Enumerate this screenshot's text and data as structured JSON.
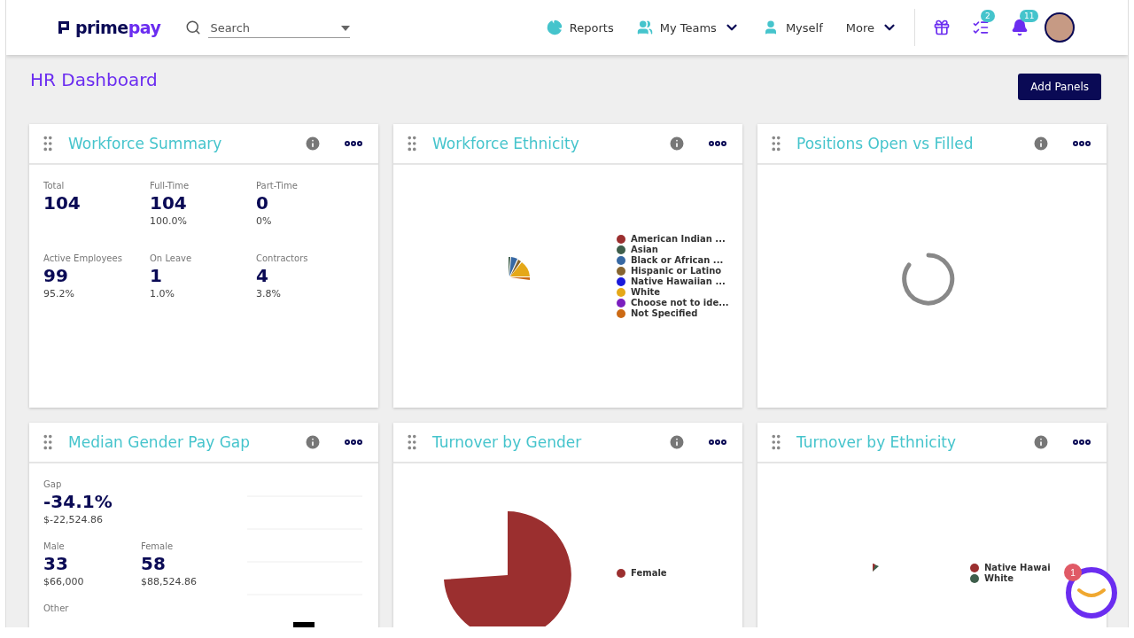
{
  "header": {
    "logo": [
      "prime",
      "pay"
    ],
    "search": {
      "placeholder": "Search"
    },
    "nav": [
      {
        "label": "Reports"
      },
      {
        "label": "My Teams"
      },
      {
        "label": "Myself"
      },
      {
        "label": "More"
      }
    ],
    "tool_badges": [
      "2",
      "11"
    ]
  },
  "page": {
    "title": "HR Dashboard",
    "button": "Add Panels"
  },
  "panels": [
    {
      "kind": "stats",
      "title": "Workforce Summary",
      "stats": [
        {
          "label": "Total",
          "value": "104"
        },
        {
          "label": "Full-Time",
          "value": "104",
          "sub": "100.0%"
        },
        {
          "label": "Part-Time",
          "value": "0",
          "sub": "0%"
        },
        {
          "label": "Active Employees",
          "value": "99",
          "sub": "95.2%"
        },
        {
          "label": "On Leave",
          "value": "1",
          "sub": "1.0%"
        },
        {
          "label": "Contractors",
          "value": "4",
          "sub": "3.8%"
        }
      ]
    },
    {
      "kind": "pie",
      "title": "Workforce Ethnicity",
      "legend": [
        {
          "label": "American Indian ...",
          "color": "#9b2f2f"
        },
        {
          "label": "Asian",
          "color": "#3e5e4b"
        },
        {
          "label": "Black or African ...",
          "color": "#3768a3"
        },
        {
          "label": "Hispanic or Latino",
          "color": "#866530"
        },
        {
          "label": "Native Hawaiian ...",
          "color": "#1a1adb"
        },
        {
          "label": "White",
          "color": "#e5a818"
        },
        {
          "label": "Choose not to ide...",
          "color": "#7b1fbf"
        },
        {
          "label": "Not Specified",
          "color": "#cc6a14"
        }
      ]
    },
    {
      "kind": "loading",
      "title": "Positions Open vs Filled"
    },
    {
      "kind": "pay_gap",
      "title": "Median Gender Pay Gap",
      "stats": [
        {
          "label": "Gap",
          "value": "-34.1%",
          "sub": "$-22,524.86"
        },
        {
          "label": "Male",
          "value": "33",
          "sub": "$66,000"
        },
        {
          "label": "Female",
          "value": "58",
          "sub": "$88,524.86"
        },
        {
          "label": "Other"
        }
      ]
    },
    {
      "kind": "pie",
      "title": "Turnover by Gender",
      "legend": [
        {
          "label": "Female",
          "color": "#9b2f2f"
        }
      ]
    },
    {
      "kind": "pie",
      "title": "Turnover by Ethnicity",
      "legend": [
        {
          "label": "Native Hawai",
          "color": "#9b2f2f"
        },
        {
          "label": "White",
          "color": "#3e5e4b"
        }
      ]
    }
  ],
  "chat": {
    "badge": "1"
  }
}
